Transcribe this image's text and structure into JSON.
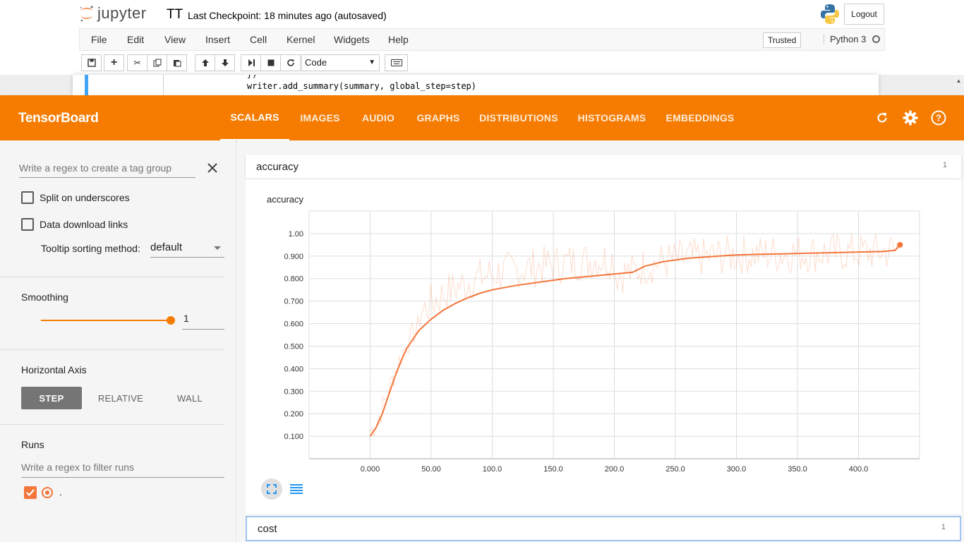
{
  "jupyter": {
    "logo_text": "jupyter",
    "notebook_name": "TT",
    "checkpoint": "Last Checkpoint: 18 minutes ago (autosaved)",
    "logout": "Logout",
    "menus": [
      "File",
      "Edit",
      "View",
      "Insert",
      "Cell",
      "Kernel",
      "Widgets",
      "Help"
    ],
    "trusted": "Trusted",
    "kernel_name": "Python 3",
    "cell_type": "Code",
    "code_lines": [
      "    })",
      "    writer.add_summary(summary, global_step=step)"
    ]
  },
  "tensorboard": {
    "brand": "TensorBoard",
    "tabs": [
      "SCALARS",
      "IMAGES",
      "AUDIO",
      "GRAPHS",
      "DISTRIBUTIONS",
      "HISTOGRAMS",
      "EMBEDDINGS"
    ],
    "active_tab": "SCALARS",
    "colors": {
      "header": "#f57c00",
      "run": "#f4763b"
    }
  },
  "sidebar": {
    "tag_regex_placeholder": "Write a regex to create a tag group",
    "split_underscores": {
      "label": "Split on underscores",
      "checked": false
    },
    "data_download": {
      "label": "Data download links",
      "checked": false
    },
    "tooltip_label": "Tooltip sorting method:",
    "tooltip_value": "default",
    "smoothing_label": "Smoothing",
    "smoothing_value": "1",
    "horizontal_axis_label": "Horizontal Axis",
    "axis_options": [
      "STEP",
      "RELATIVE",
      "WALL"
    ],
    "axis_selected": "STEP",
    "runs_label": "Runs",
    "runs_regex_placeholder": "Write a regex to filter runs",
    "runs": [
      {
        "name": ".",
        "checked": true
      }
    ]
  },
  "main": {
    "categories": [
      {
        "name": "accuracy",
        "count": "1"
      },
      {
        "name": "cost",
        "count": "1"
      }
    ],
    "card_title": "accuracy"
  },
  "chart_data": {
    "type": "line",
    "title": "accuracy",
    "xlabel": "",
    "ylabel": "",
    "xlim": [
      -50,
      450
    ],
    "ylim": [
      0.0,
      1.1
    ],
    "x_ticks": [
      "0.000",
      "50.00",
      "100.0",
      "150.0",
      "200.0",
      "250.0",
      "300.0",
      "350.0",
      "400.0"
    ],
    "y_ticks": [
      "0.100",
      "0.200",
      "0.300",
      "0.400",
      "0.500",
      "0.600",
      "0.700",
      "0.800",
      "0.900",
      "1.00"
    ],
    "grid": true,
    "series": [
      {
        "name": ".",
        "x": [
          0,
          5,
          10,
          15,
          20,
          25,
          30,
          40,
          50,
          60,
          70,
          80,
          90,
          100,
          120,
          140,
          160,
          180,
          200,
          215,
          225,
          240,
          260,
          280,
          300,
          320,
          340,
          360,
          380,
          400,
          420,
          430,
          434
        ],
        "values": [
          0.1,
          0.14,
          0.2,
          0.28,
          0.36,
          0.43,
          0.49,
          0.57,
          0.62,
          0.66,
          0.69,
          0.715,
          0.735,
          0.75,
          0.77,
          0.785,
          0.8,
          0.81,
          0.82,
          0.828,
          0.855,
          0.875,
          0.89,
          0.898,
          0.905,
          0.908,
          0.91,
          0.913,
          0.915,
          0.918,
          0.92,
          0.925,
          0.95
        ]
      }
    ]
  }
}
